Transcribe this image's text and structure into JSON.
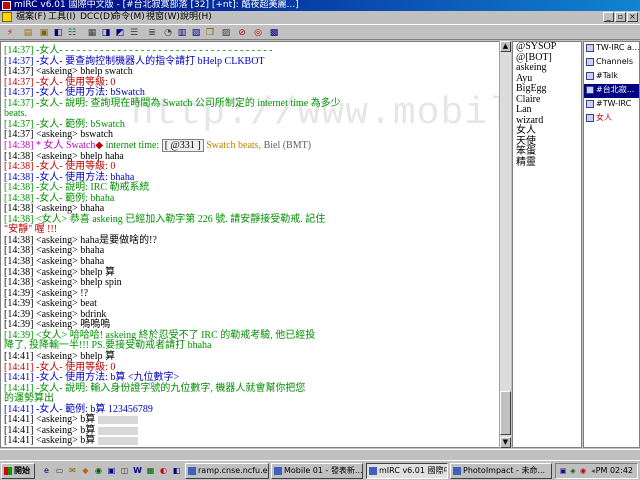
{
  "window": {
    "title": "mIRC v6.01 國際中文版 - [#台北寂寞部落 [32] [+nt]: 酷夜超美麗...]",
    "menu": [
      "檔案(F)",
      "工具(I)",
      "DCC(D)",
      "命令(M)",
      "視窗(W)",
      "說明(H)"
    ]
  },
  "chat": {
    "lines": [
      {
        "t": "[14:37] -女人- - - - - - - - - - - - - - - - - - - - - - - - - - - - - - - - - - - - -",
        "c": "#009000"
      },
      {
        "t": "[14:37] -女人- 要查詢控制機器人的指令請打 bHelp CLKBOT",
        "c": "#0000c0"
      },
      {
        "t": "[14:37] <askeing> bhelp swatch",
        "c": "#000000"
      },
      {
        "t": "[14:37] -女人- 使用等級: 0",
        "c": "#c00000"
      },
      {
        "t": "[14:37] -女人- 使用方法: bSwatch",
        "c": "#0000c0"
      },
      {
        "t": "[14:37] -女人- 說明: 查詢現在時間為 Swatch 公司所制定的 internet time 為多少",
        "c": "#009000"
      },
      {
        "t": "  beats.",
        "c": "#009000"
      },
      {
        "t": "[14:37] -女人- 範例: bSwatch",
        "c": "#009000"
      },
      {
        "t": "[14:37] <askeing> bswatch",
        "c": "#000000"
      },
      {
        "t": "[14:38] * 女人 Swatch internet time: [ @331 ] Swatch beats, Biel (BMT)",
        "c": "#c000c0",
        "special": true
      },
      {
        "t": "[14:38] <askeing> bhelp haha",
        "c": "#000000"
      },
      {
        "t": "[14:38] -女人- 使用等級: 0",
        "c": "#c00000"
      },
      {
        "t": "[14:38] -女人- 使用方法: bhaha",
        "c": "#0000c0"
      },
      {
        "t": "[14:38] -女人- 說明: IRC 勒戒系統",
        "c": "#009000"
      },
      {
        "t": "[14:38] -女人- 範例: bhaha",
        "c": "#009000"
      },
      {
        "t": "[14:38] <askeing> bhaha",
        "c": "#000000"
      },
      {
        "t": "[14:38] <女人> 恭喜 askeing 已經加入勒字第 226 號. 請安靜接受勒戒. 記住",
        "c": "#009000"
      },
      {
        "t": "  \"安靜\" 喔 !!!",
        "c": "#c00000"
      },
      {
        "t": "[14:38] <askeing> haha是要做啥的!?",
        "c": "#000000"
      },
      {
        "t": "[14:38] <askeing> bhaha",
        "c": "#000000"
      },
      {
        "t": "[14:38] <askeing> bhaha",
        "c": "#000000"
      },
      {
        "t": "[14:38] <askeing> bhelp 算",
        "c": "#000000"
      },
      {
        "t": "[14:38] <askeing> bhelp spin",
        "c": "#000000"
      },
      {
        "t": "[14:39] <askeing> !?",
        "c": "#000000"
      },
      {
        "t": "[14:39] <askeing> beat",
        "c": "#000000"
      },
      {
        "t": "[14:39] <askeing> bdrink",
        "c": "#000000"
      },
      {
        "t": "[14:39] <askeing> 嗚嗚嗚",
        "c": "#000000"
      },
      {
        "t": "[14:39] <女人> 哈哈哈! askeing 終於忍受不了 IRC 的勒戒考驗, 他已經投",
        "c": "#009000"
      },
      {
        "t": "  降了, 投降輸一半!!! PS.要接受勒戒者請打 bhaha",
        "c": "#009000"
      },
      {
        "t": "[14:41] <askeing> bhelp 算",
        "c": "#000000"
      },
      {
        "t": "[14:41] -女人- 使用等級: 0",
        "c": "#c00000"
      },
      {
        "t": "[14:41] -女人- 使用方法: b算 <九位數字>",
        "c": "#0000c0"
      },
      {
        "t": "[14:41] -女人- 說明: 輸入身份證字號的九位數字, 機器人就會幫你把您",
        "c": "#009000"
      },
      {
        "t": "  的運勢算出",
        "c": "#009000"
      },
      {
        "t": "[14:41] -女人- 範例: b算 123456789",
        "c": "#0000c0"
      },
      {
        "t": "[14:41] <askeing> b算",
        "c": "#000000",
        "blur": true
      },
      {
        "t": "[14:41] <askeing> b算",
        "c": "#000000",
        "blur": true
      },
      {
        "t": "[14:41] <askeing> b算",
        "c": "#000000",
        "blur": true
      }
    ],
    "swatch_prefix": "[14:38] * 女人 Swatch",
    "swatch_mid": " internet time: ",
    "swatch_box": "[ @331 ]",
    "swatch_tail": " Swatch beats,",
    "swatch_end": " Biel (BMT)",
    "watermark": "http://www.mobile01.com"
  },
  "nicklist": [
    "@SYSOP",
    "@[BOT]",
    "askeing",
    "Ayu",
    "BigEgg",
    "Claire",
    "Lan",
    "wizard",
    "女人",
    "天使",
    "笨蛋",
    "精靈"
  ],
  "tree": [
    {
      "label": "TW-IRC a...",
      "sel": false
    },
    {
      "label": "Channels",
      "sel": false
    },
    {
      "label": "#Talk",
      "sel": false
    },
    {
      "label": "#台北寂...",
      "sel": true
    },
    {
      "label": "#TW-IRC",
      "sel": false
    },
    {
      "label": "女人",
      "sel": false
    }
  ],
  "taskbar": {
    "start": "開始",
    "tasks": [
      {
        "label": "ramp.cnse.ncfu.edu.tw...",
        "active": false
      },
      {
        "label": "Mobile 01 - 發表新...",
        "active": false
      },
      {
        "label": "mIRC v6.01 國際中...",
        "active": true
      },
      {
        "label": "PhotoImpact - 未命...",
        "active": false
      }
    ],
    "clock": "PM 02:42"
  }
}
